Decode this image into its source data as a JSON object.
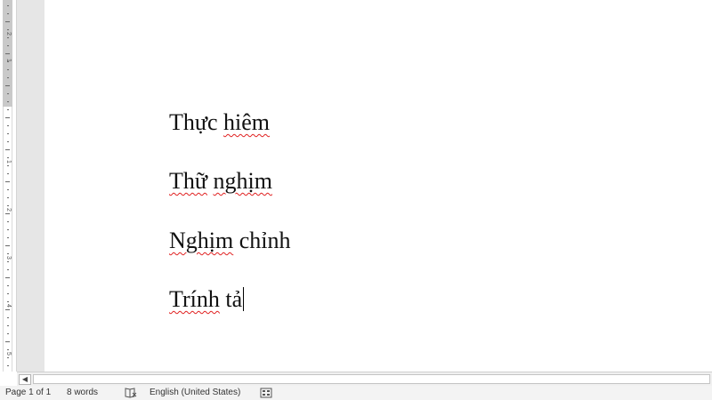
{
  "document": {
    "lines": [
      [
        {
          "text": "Thực ",
          "sq": false
        },
        {
          "text": "hiêm",
          "sq": true
        }
      ],
      [
        {
          "text": "Thữ",
          "sq": true
        },
        {
          "text": " ",
          "sq": false
        },
        {
          "text": "nghịm",
          "sq": true
        }
      ],
      [
        {
          "text": "Nghịm",
          "sq": true
        },
        {
          "text": " chỉnh",
          "sq": false
        }
      ],
      [
        {
          "text": "Trính",
          "sq": true
        },
        {
          "text": " tả",
          "sq": false
        }
      ]
    ]
  },
  "ruler": {
    "numbers": [
      "2",
      "1",
      "1",
      "2",
      "3",
      "4",
      "5"
    ]
  },
  "status_bar": {
    "page": "Page 1 of 1",
    "words": "8 words",
    "language": "English (United States)",
    "proofing_icon": "proofing-book-icon",
    "layout_icon": "track-changes-icon"
  },
  "colors": {
    "squiggle": "#e02020",
    "gutter": "#e6e6e6",
    "status_bg": "#f3f3f3"
  }
}
